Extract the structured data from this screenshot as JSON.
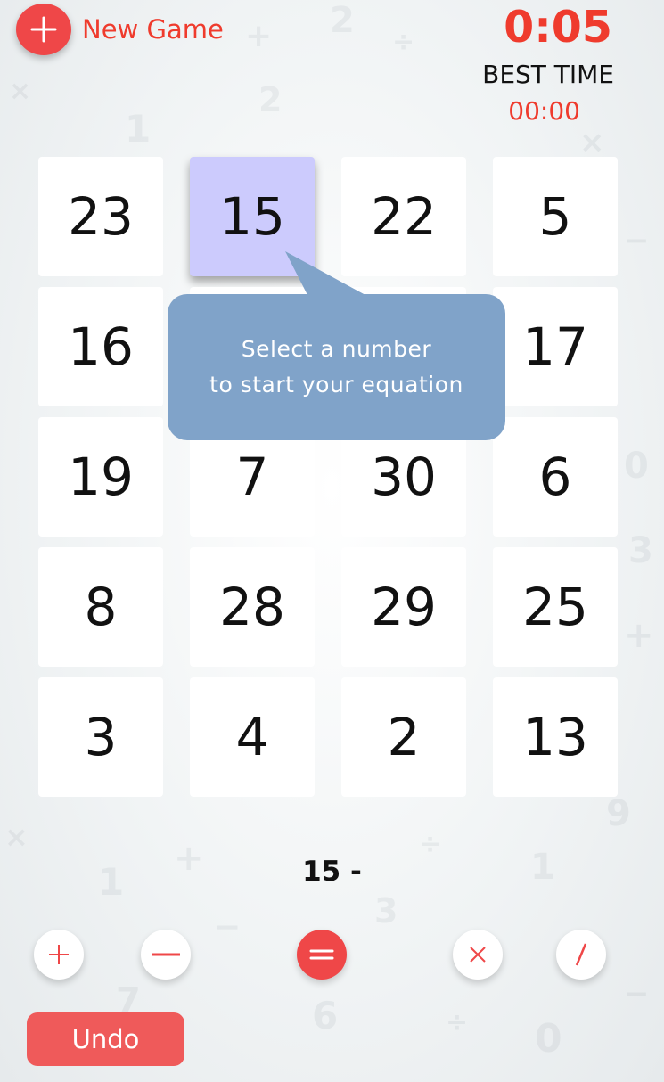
{
  "header": {
    "new_game_label": "New Game",
    "timer": "0:05",
    "best_time_label": "BEST TIME",
    "best_time_value": "00:00"
  },
  "board": {
    "rows": [
      [
        "23",
        "15",
        "22",
        "5"
      ],
      [
        "16",
        "",
        "",
        "17"
      ],
      [
        "19",
        "7",
        "30",
        "6"
      ],
      [
        "8",
        "28",
        "29",
        "25"
      ],
      [
        "3",
        "4",
        "2",
        "13"
      ]
    ],
    "selected": "15"
  },
  "tooltip": {
    "line1": "Select a number",
    "line2": "to start your equation"
  },
  "equation": "15 -",
  "operators": [
    {
      "name": "plus-icon",
      "active": false
    },
    {
      "name": "minus-icon",
      "active": false
    },
    {
      "name": "equals-icon",
      "active": true
    },
    {
      "name": "multiply-icon",
      "active": false
    },
    {
      "name": "divide-icon",
      "active": false
    }
  ],
  "undo_label": "Undo",
  "colors": {
    "accent": "#ef4748",
    "timer": "#ef3b2d",
    "selected_tile": "#cccbfd",
    "tooltip": "#80a3c9",
    "undo": "#ef5a5a"
  }
}
